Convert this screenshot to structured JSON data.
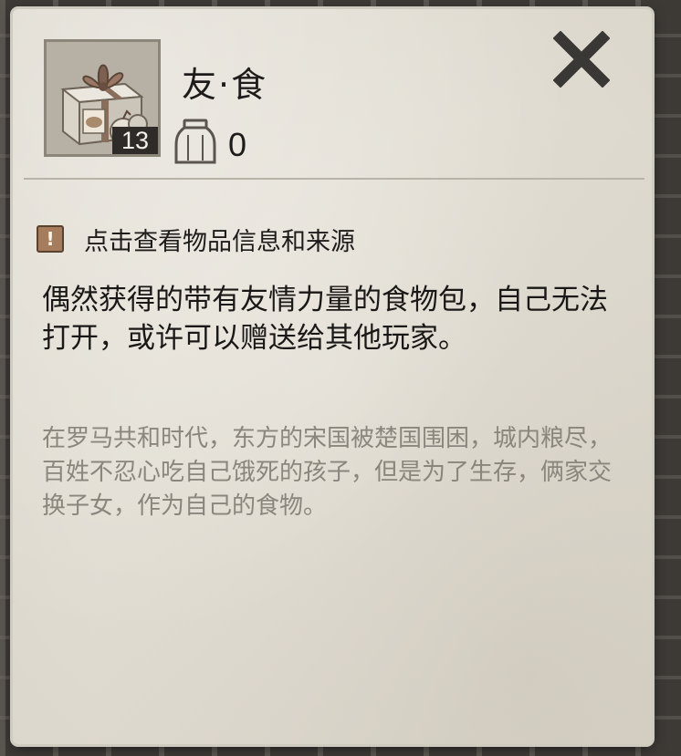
{
  "item": {
    "name": "友·食",
    "count": "13",
    "icon": "gift-box-food-icon"
  },
  "storage": {
    "icon": "jar-icon",
    "count": "0"
  },
  "hint": {
    "icon": "exclamation-icon",
    "symbol": "!",
    "text": "点击查看物品信息和来源"
  },
  "description": "偶然获得的带有友情力量的食物包，自己无法打开，或许可以赠送给其他玩家。",
  "lore": "在罗马共和时代，东方的宋国被楚国围困，城内粮尽，百姓不忍心吃自己饿死的孩子，但是为了生存，俩家交换子女，作为自己的食物。",
  "close": {
    "icon": "close-icon"
  },
  "colors": {
    "panel": "#e5e1d8",
    "text": "#1e1c1a",
    "lore_text": "#8a857d",
    "warn_badge": "#a57c5c"
  }
}
